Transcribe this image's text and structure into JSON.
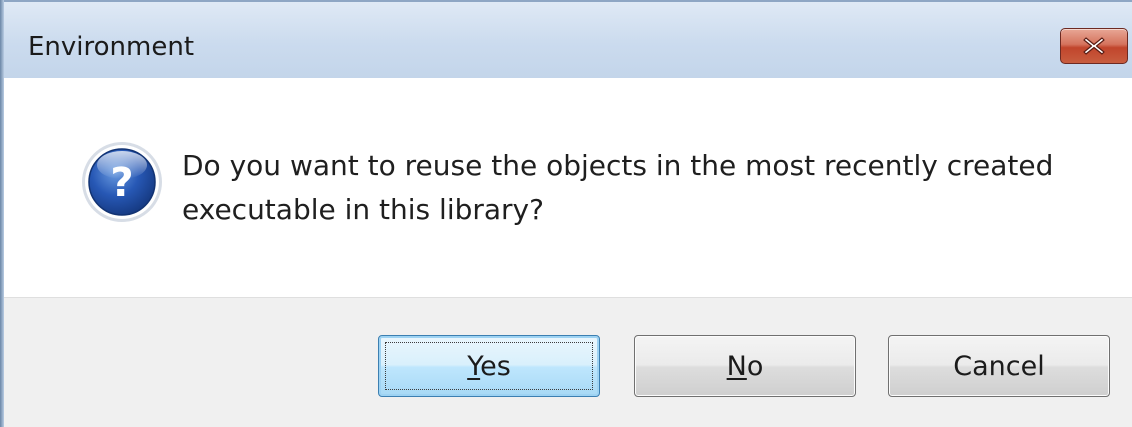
{
  "window": {
    "title": "Environment",
    "close_icon": "close-x-icon"
  },
  "message": {
    "icon": "question-icon",
    "text": "Do you want to reuse the objects in the most recently created executable in this library?"
  },
  "buttons": {
    "yes": {
      "accel": "Y",
      "rest": "es",
      "default": true
    },
    "no": {
      "accel": "N",
      "rest": "o"
    },
    "cancel": {
      "label": "Cancel"
    }
  },
  "colors": {
    "titlebar": "#cbdbee",
    "close_button": "#c1452c",
    "footer": "#f0f0f0",
    "default_button": "#bee6fd",
    "question_icon": "#1f4fa0"
  }
}
